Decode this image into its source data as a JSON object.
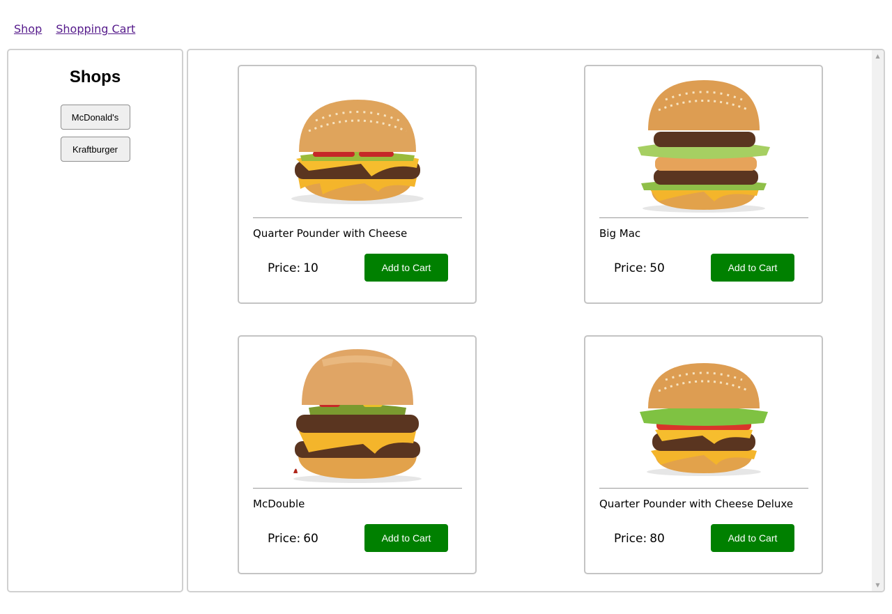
{
  "nav": {
    "shop": "Shop",
    "cart": "Shopping Cart"
  },
  "sidebar": {
    "title": "Shops",
    "shops": [
      {
        "label": "McDonald's"
      },
      {
        "label": "Kraftburger"
      }
    ]
  },
  "products": [
    {
      "name": "Quarter Pounder with Cheese",
      "price_label": "Price:",
      "price": "10",
      "button": "Add to Cart"
    },
    {
      "name": "Big Mac",
      "price_label": "Price:",
      "price": "50",
      "button": "Add to Cart"
    },
    {
      "name": "McDouble",
      "price_label": "Price:",
      "price": "60",
      "button": "Add to Cart"
    },
    {
      "name": "Quarter Pounder with Cheese Deluxe",
      "price_label": "Price:",
      "price": "80",
      "button": "Add to Cart"
    }
  ],
  "colors": {
    "button": "#008000",
    "link": "#551a8b",
    "border": "#c4c4c4"
  }
}
